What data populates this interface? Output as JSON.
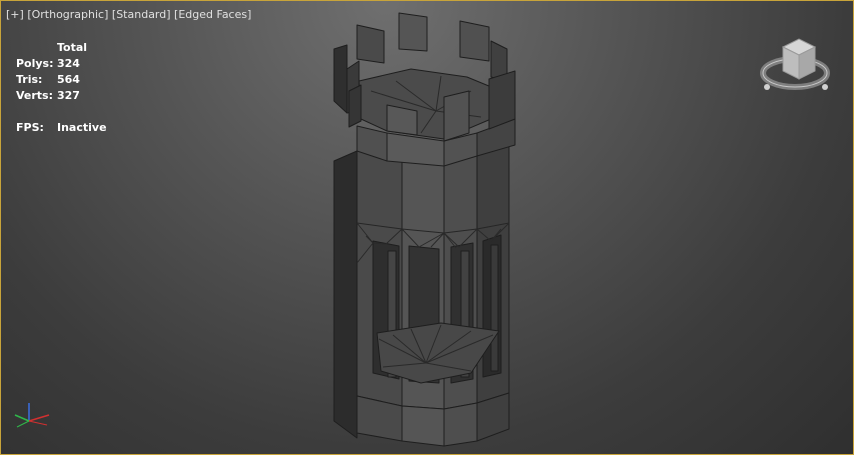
{
  "viewport": {
    "menu": "[+]",
    "view": "[Orthographic]",
    "shading": "[Standard]",
    "display": "[Edged Faces]"
  },
  "stats": {
    "header": "Total",
    "polys_label": "Polys:",
    "polys_value": "324",
    "tris_label": "Tris:",
    "tris_value": "564",
    "verts_label": "Verts:",
    "verts_value": "327",
    "fps_label": "FPS:",
    "fps_value": "Inactive"
  },
  "colors": {
    "border": "#c8a43a",
    "axis_x": "#d23030",
    "axis_y": "#2fb84a",
    "axis_z": "#3a6ee0"
  },
  "icons": [
    "viewcube-icon",
    "axis-tripod-icon"
  ],
  "model": "tower"
}
